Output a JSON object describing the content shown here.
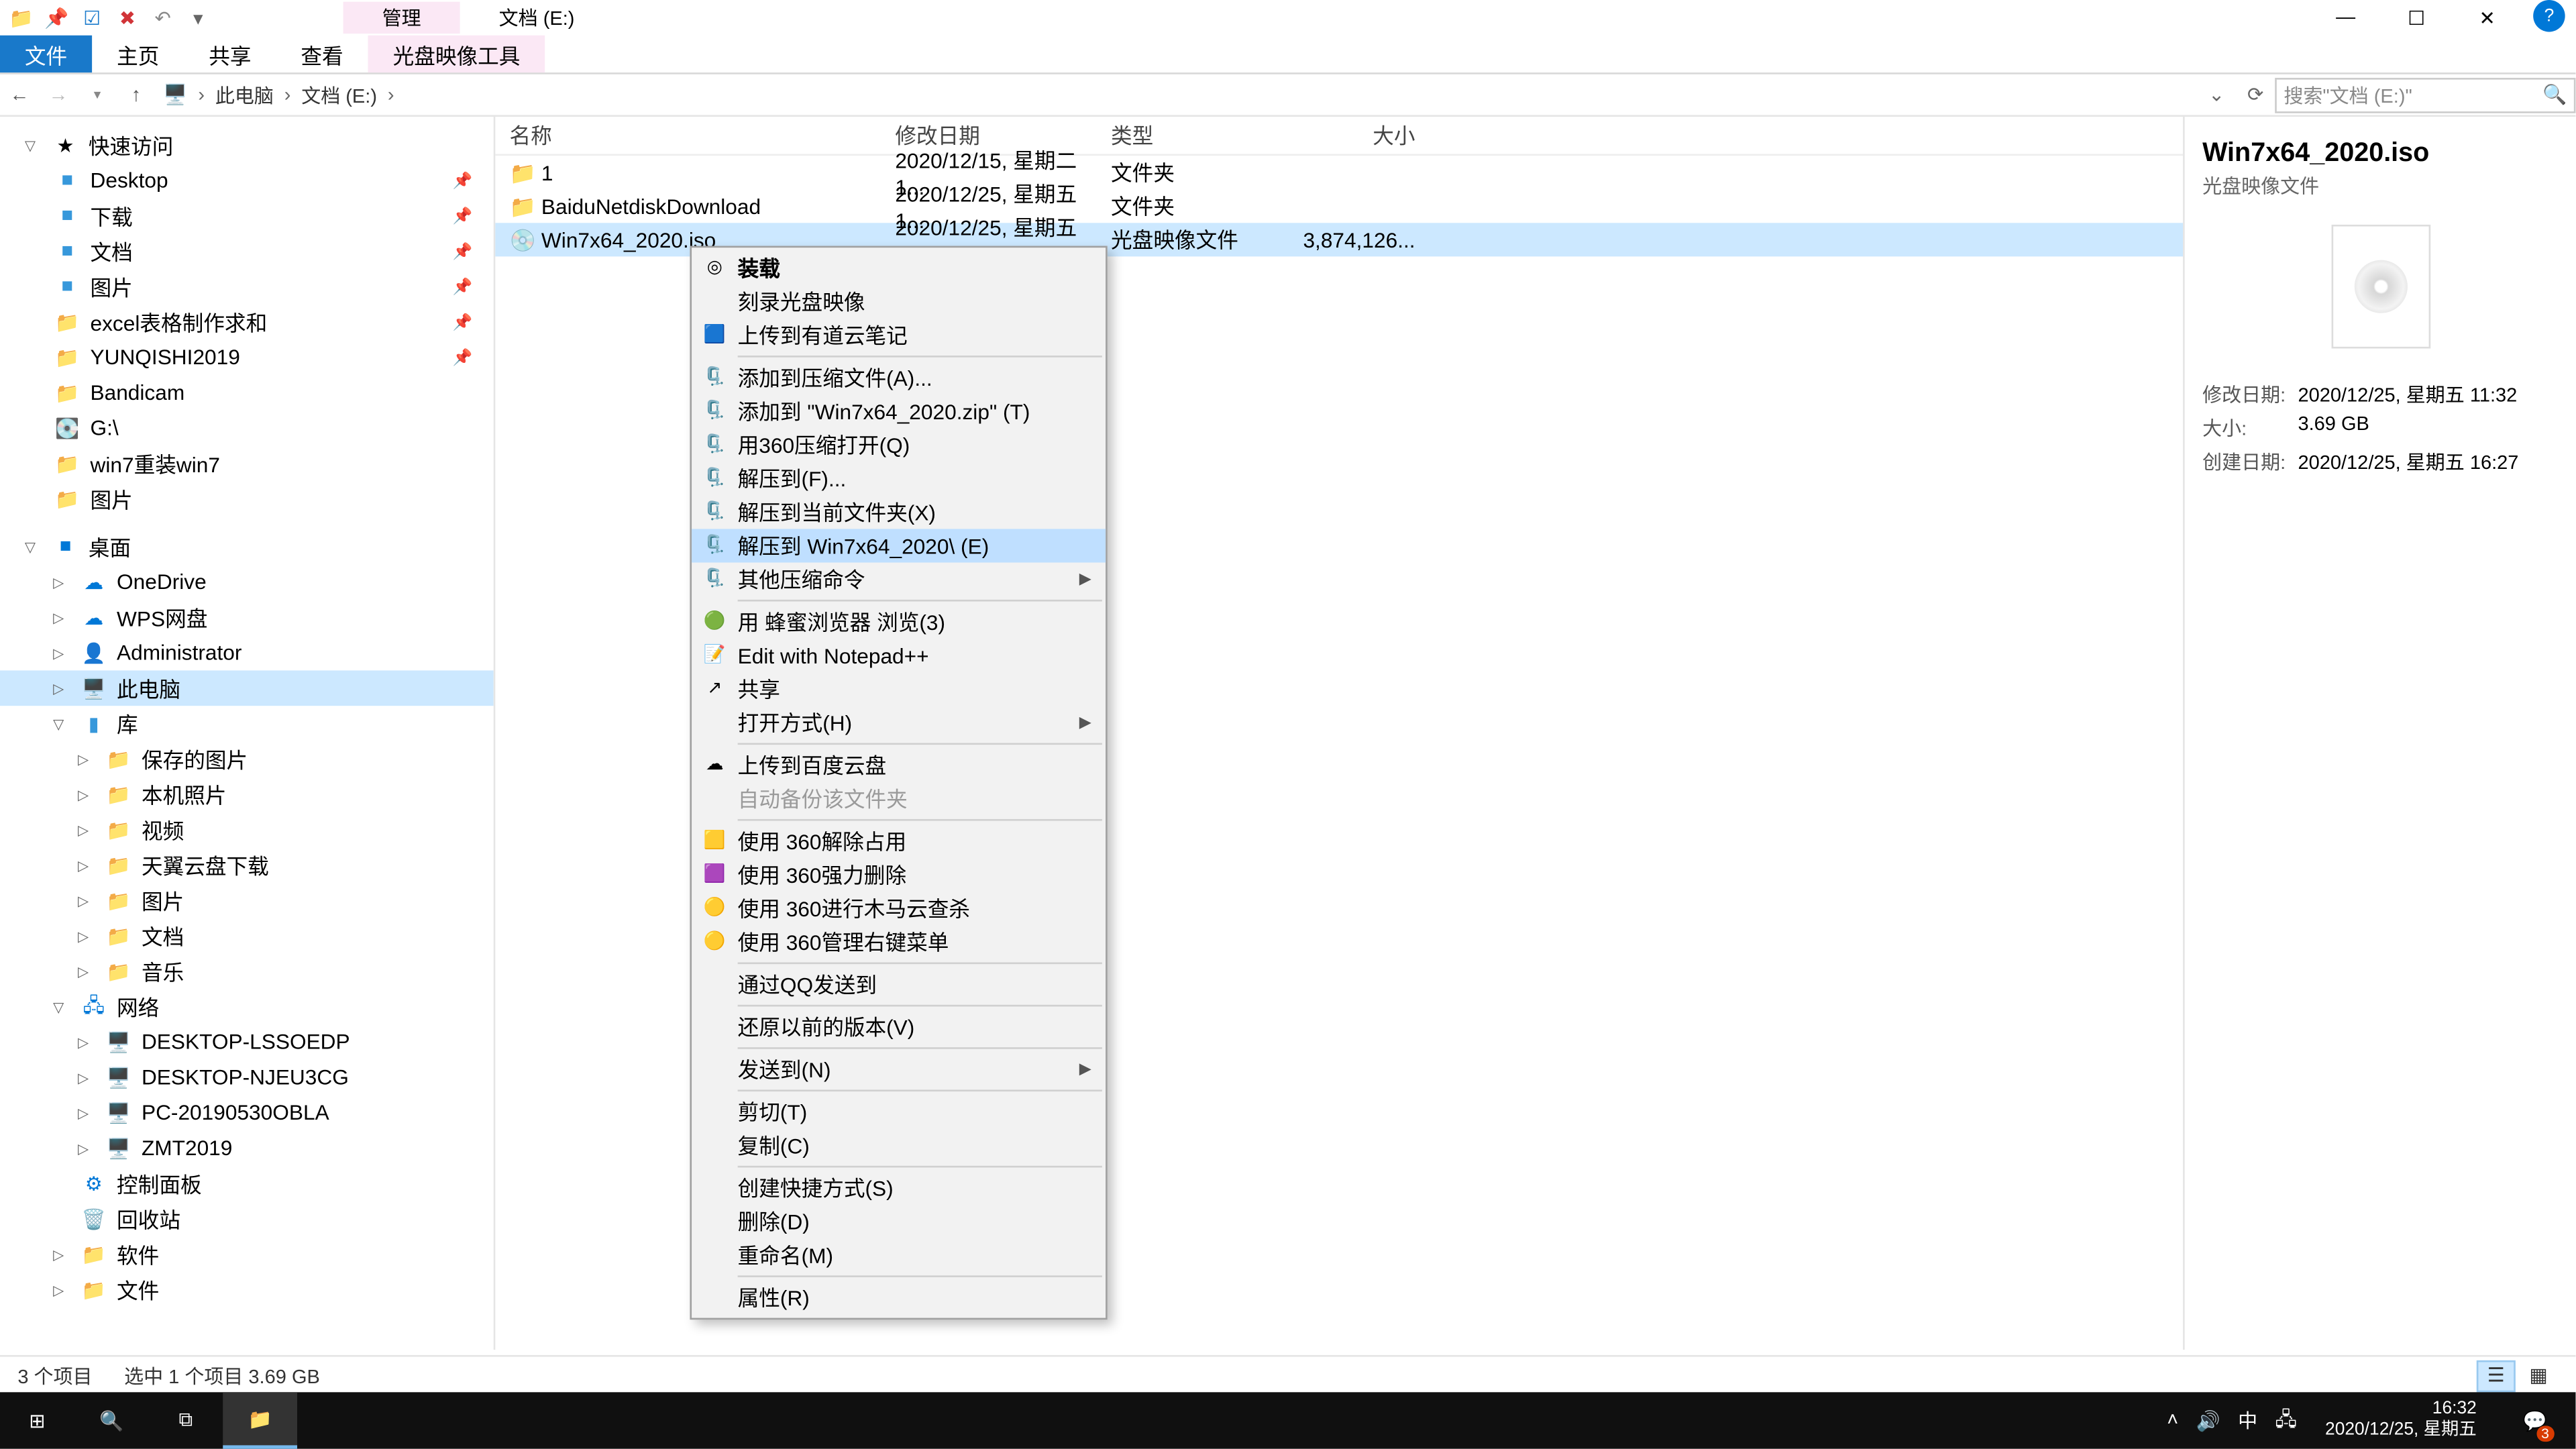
{
  "titlebar": {
    "manage_tab": "管理",
    "title": "文档 (E:)"
  },
  "winbtn": {
    "min": "—",
    "max": "☐",
    "close": "✕"
  },
  "ribbon": {
    "file": "文件",
    "home": "主页",
    "share": "共享",
    "view": "查看",
    "tools": "光盘映像工具"
  },
  "addr": {
    "thispc": "此电脑",
    "drive": "文档 (E:)",
    "search_placeholder": "搜索\"文档 (E:)\""
  },
  "tree": {
    "quick": "快速访问",
    "desktop": "Desktop",
    "downloads": "下载",
    "documents": "文档",
    "pictures": "图片",
    "excel": "excel表格制作求和",
    "yunqishi": "YUNQISHI2019",
    "bandicam": "Bandicam",
    "g": "G:\\",
    "win7re": "win7重装win7",
    "pictures2": "图片",
    "desk_cn": "桌面",
    "onedrive": "OneDrive",
    "wps": "WPS网盘",
    "admin": "Administrator",
    "thispc": "此电脑",
    "lib": "库",
    "saved_pic": "保存的图片",
    "local_pic": "本机照片",
    "video": "视频",
    "tianyi": "天翼云盘下载",
    "pic3": "图片",
    "doc3": "文档",
    "music": "音乐",
    "network": "网络",
    "pc1": "DESKTOP-LSSOEDP",
    "pc2": "DESKTOP-NJEU3CG",
    "pc3": "PC-20190530OBLA",
    "pc4": "ZMT2019",
    "ctrl": "控制面板",
    "recycle": "回收站",
    "soft": "软件",
    "files": "文件"
  },
  "cols": {
    "name": "名称",
    "date": "修改日期",
    "type": "类型",
    "size": "大小"
  },
  "rows": [
    {
      "icon": "folder",
      "name": "1",
      "date": "2020/12/15, 星期二 1...",
      "type": "文件夹",
      "size": ""
    },
    {
      "icon": "folder",
      "name": "BaiduNetdiskDownload",
      "date": "2020/12/25, 星期五 1...",
      "type": "文件夹",
      "size": ""
    },
    {
      "icon": "iso",
      "name": "Win7x64_2020.iso",
      "date": "2020/12/25, 星期五 1...",
      "type": "光盘映像文件",
      "size": "3,874,126..."
    }
  ],
  "ctx": [
    {
      "t": "装载",
      "b": true,
      "i": "disc"
    },
    {
      "t": "刻录光盘映像"
    },
    {
      "t": "上传到有道云笔记",
      "i": "blue"
    },
    {
      "sep": true
    },
    {
      "t": "添加到压缩文件(A)...",
      "i": "zip"
    },
    {
      "t": "添加到 \"Win7x64_2020.zip\" (T)",
      "i": "zip"
    },
    {
      "t": "用360压缩打开(Q)",
      "i": "zip"
    },
    {
      "t": "解压到(F)...",
      "i": "zip"
    },
    {
      "t": "解压到当前文件夹(X)",
      "i": "zip"
    },
    {
      "t": "解压到 Win7x64_2020\\ (E)",
      "i": "zip",
      "hover": true
    },
    {
      "t": "其他压缩命令",
      "i": "zip",
      "sub": true
    },
    {
      "sep": true
    },
    {
      "t": "用 蜂蜜浏览器 浏览(3)",
      "i": "green"
    },
    {
      "t": "Edit with Notepad++",
      "i": "npp"
    },
    {
      "t": "共享",
      "i": "share"
    },
    {
      "t": "打开方式(H)",
      "sub": true
    },
    {
      "sep": true
    },
    {
      "t": "上传到百度云盘",
      "i": "cloud"
    },
    {
      "t": "自动备份该文件夹",
      "disabled": true
    },
    {
      "sep": true
    },
    {
      "t": "使用 360解除占用",
      "i": "360y"
    },
    {
      "t": "使用 360强力删除",
      "i": "360p"
    },
    {
      "t": "使用 360进行木马云查杀",
      "i": "360g"
    },
    {
      "t": "使用 360管理右键菜单",
      "i": "360g"
    },
    {
      "sep": true
    },
    {
      "t": "通过QQ发送到"
    },
    {
      "sep": true
    },
    {
      "t": "还原以前的版本(V)"
    },
    {
      "sep": true
    },
    {
      "t": "发送到(N)",
      "sub": true
    },
    {
      "sep": true
    },
    {
      "t": "剪切(T)"
    },
    {
      "t": "复制(C)"
    },
    {
      "sep": true
    },
    {
      "t": "创建快捷方式(S)"
    },
    {
      "t": "删除(D)"
    },
    {
      "t": "重命名(M)"
    },
    {
      "sep": true
    },
    {
      "t": "属性(R)"
    }
  ],
  "preview": {
    "name": "Win7x64_2020.iso",
    "type": "光盘映像文件",
    "mdate_l": "修改日期:",
    "mdate": "2020/12/25, 星期五 11:32",
    "size_l": "大小:",
    "size": "3.69 GB",
    "cdate_l": "创建日期:",
    "cdate": "2020/12/25, 星期五 16:27"
  },
  "status": {
    "count": "3 个项目",
    "sel": "选中 1 个项目  3.69 GB"
  },
  "taskbar": {
    "time": "16:32",
    "date": "2020/12/25, 星期五",
    "notif": "3",
    "ime": "中"
  }
}
